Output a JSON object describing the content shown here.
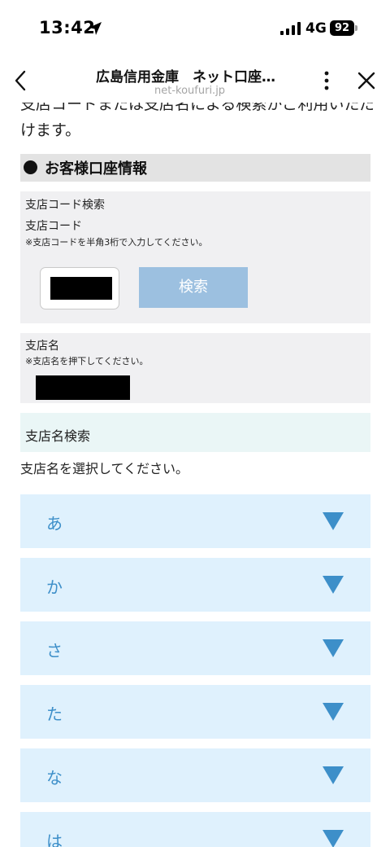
{
  "status_bar": {
    "time": "13:42",
    "network": "4G",
    "battery": "92"
  },
  "browser": {
    "title": "広島信用金庫　ネット口座…",
    "url": "net-koufuri.jp"
  },
  "intro": {
    "text": "支店コードまたは支店名による検索がご利用いただけます。"
  },
  "section": {
    "title": "お客様口座情報"
  },
  "branch_code_search": {
    "heading": "支店コード検索",
    "field_label": "支店コード",
    "note": "※支店コードを半角3桁で入力してください。",
    "button_label": "検索"
  },
  "branch_name": {
    "label": "支店名",
    "note": "※支店名を押下してください。"
  },
  "branch_name_search": {
    "heading": "支店名検索",
    "hint": "支店名を選択してください。",
    "kana_rows": [
      "あ",
      "か",
      "さ",
      "た",
      "な",
      "は"
    ]
  },
  "colors": {
    "accent": "#3d8fc9",
    "row_background": "#dff1fd",
    "button_disabled": "#9cc0e0"
  }
}
